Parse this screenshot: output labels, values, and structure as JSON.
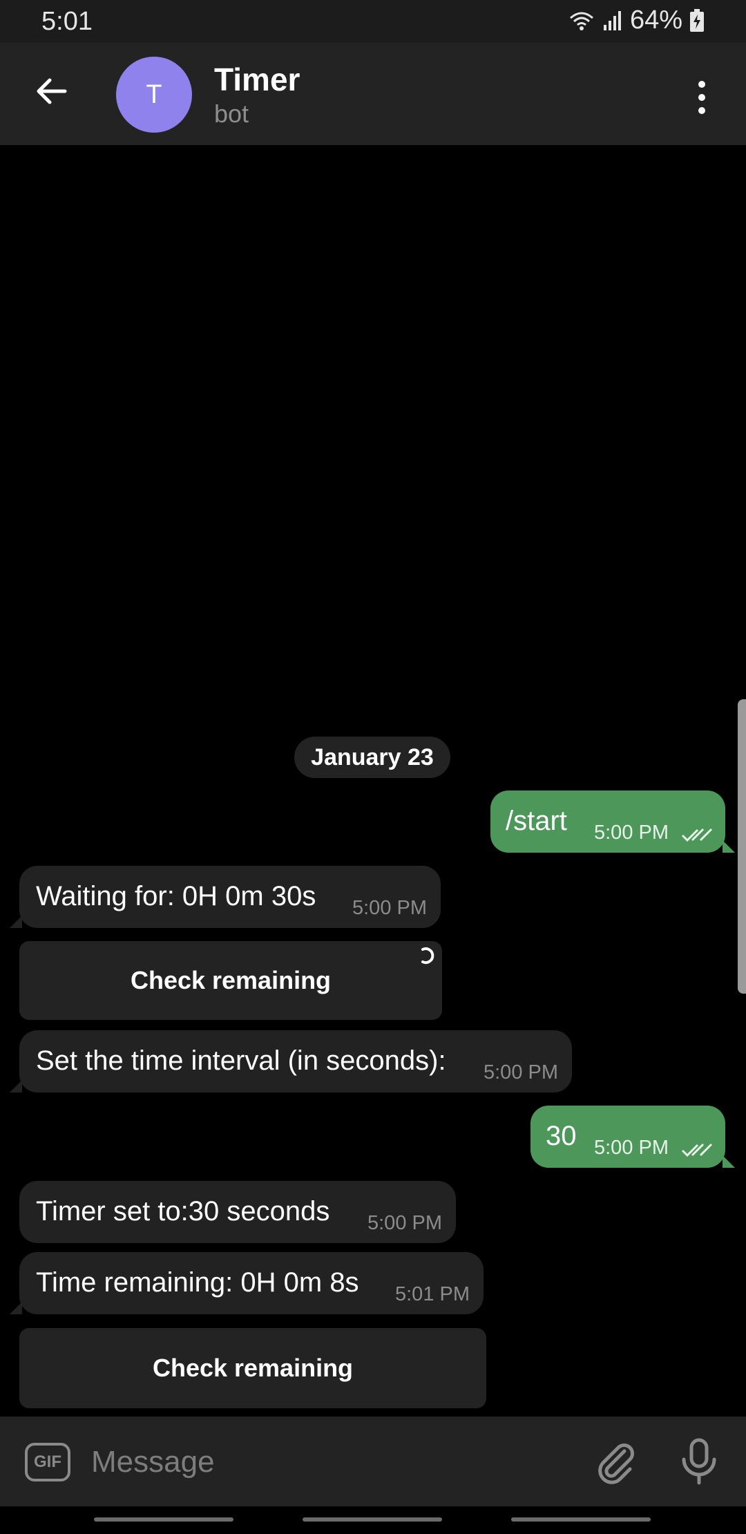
{
  "status_bar": {
    "time": "5:01",
    "battery": "64%"
  },
  "header": {
    "avatar_letter": "T",
    "avatar_color": "#8f82ec",
    "title": "Timer",
    "subtitle": "bot"
  },
  "chat": {
    "date": "January 23",
    "messages": [
      {
        "direction": "out",
        "text": "/start",
        "time": "5:00 PM",
        "read": true
      },
      {
        "direction": "in",
        "text": "Waiting for: 0H 0m 30s",
        "time": "5:00 PM"
      },
      {
        "direction": "in",
        "text": "Set the time interval (in seconds):",
        "time": "5:00 PM"
      },
      {
        "direction": "out",
        "text": "30",
        "time": "5:00 PM",
        "read": true
      },
      {
        "direction": "in",
        "text": "Timer set to:30 seconds",
        "time": "5:00 PM"
      },
      {
        "direction": "in",
        "text": "Time remaining: 0H 0m 8s",
        "time": "5:01 PM"
      }
    ],
    "keyboard_buttons": [
      {
        "label": "Check remaining",
        "loading": true
      },
      {
        "label": "Check remaining",
        "loading": false
      }
    ]
  },
  "input": {
    "gif_label": "GIF",
    "placeholder": "Message"
  },
  "colors": {
    "outgoing_bubble": "#4c9759",
    "incoming_bubble": "#222222",
    "header_bg": "#232323"
  }
}
